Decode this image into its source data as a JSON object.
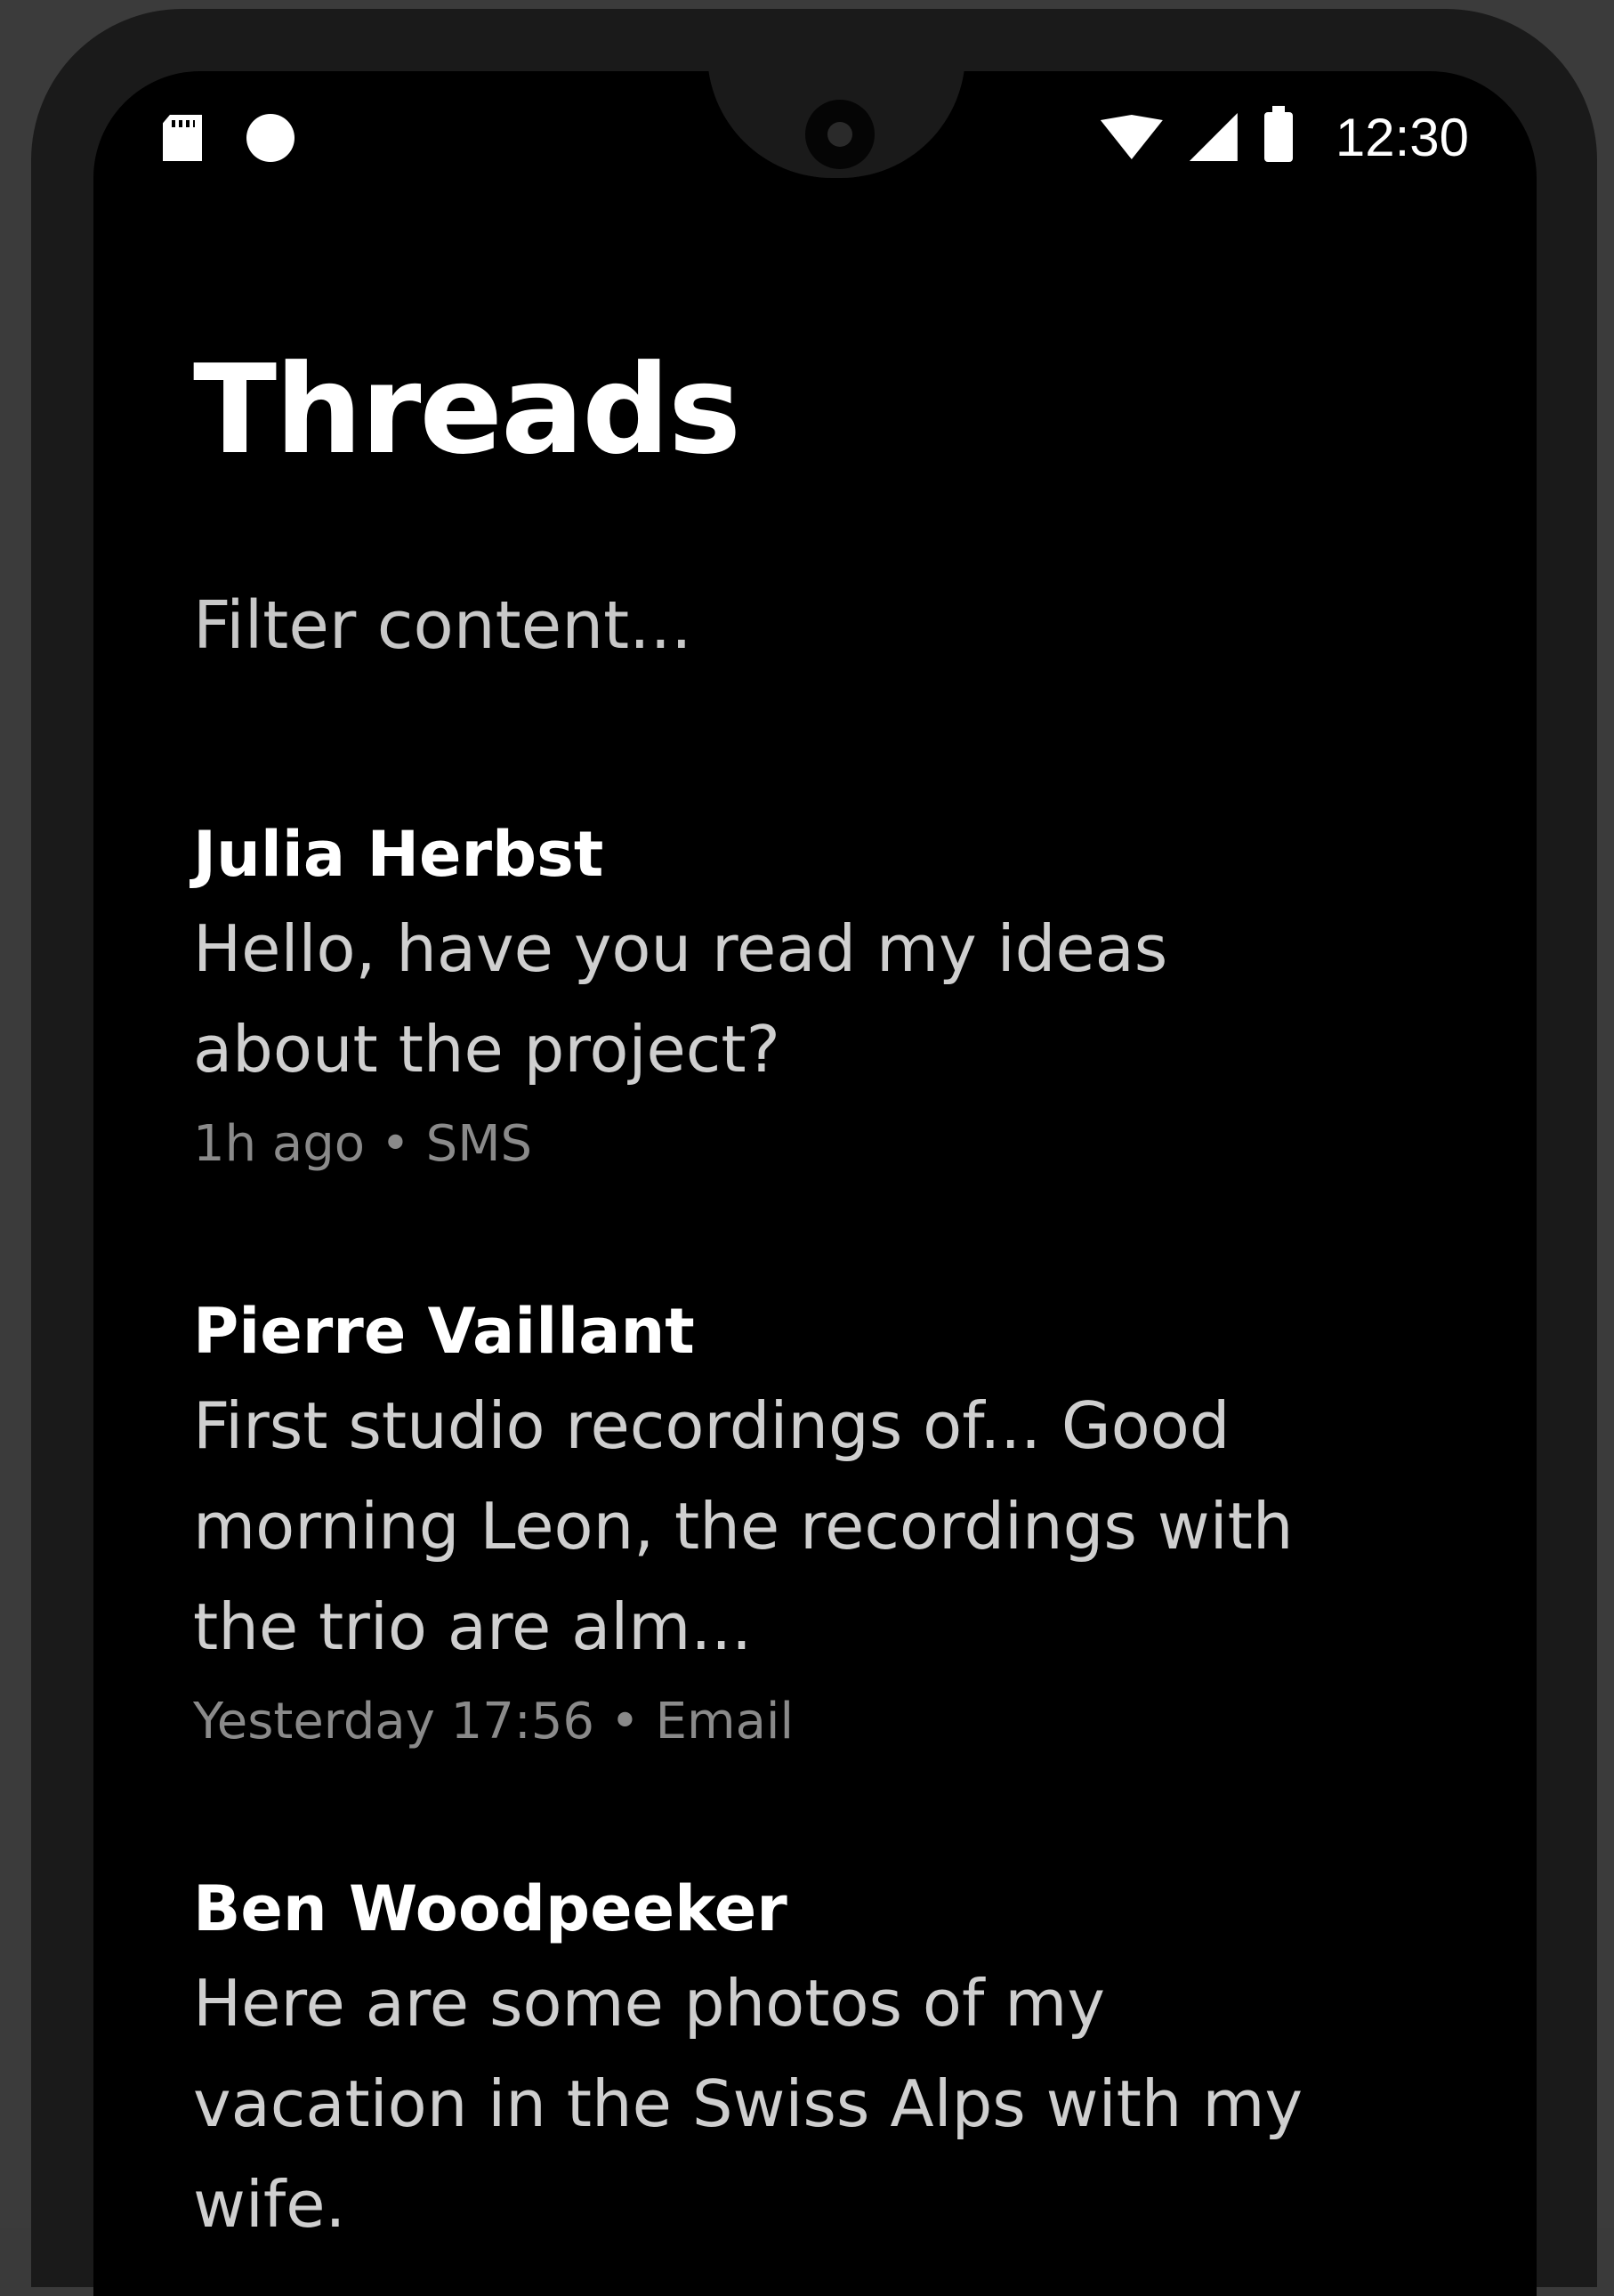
{
  "status_bar": {
    "time": "12:30",
    "left_icons": [
      "sd-card-icon",
      "notification-dot-icon"
    ],
    "right_icons": [
      "wifi-icon",
      "cell-signal-icon",
      "battery-icon"
    ]
  },
  "header": {
    "title": "Threads"
  },
  "filter": {
    "placeholder": "Filter content..."
  },
  "threads": [
    {
      "name": "Julia Herbst",
      "preview": "Hello, have you read my ideas about the project?",
      "meta": "1h ago • SMS"
    },
    {
      "name": "Pierre Vaillant",
      "preview": "First studio recordings of... Good morning Leon, the recordings with the trio are alm...",
      "meta": "Yesterday 17:56 • Email"
    },
    {
      "name": "Ben Woodpeeker",
      "preview": "Here are some photos of my vacation in the Swiss Alps with my wife."
    }
  ]
}
